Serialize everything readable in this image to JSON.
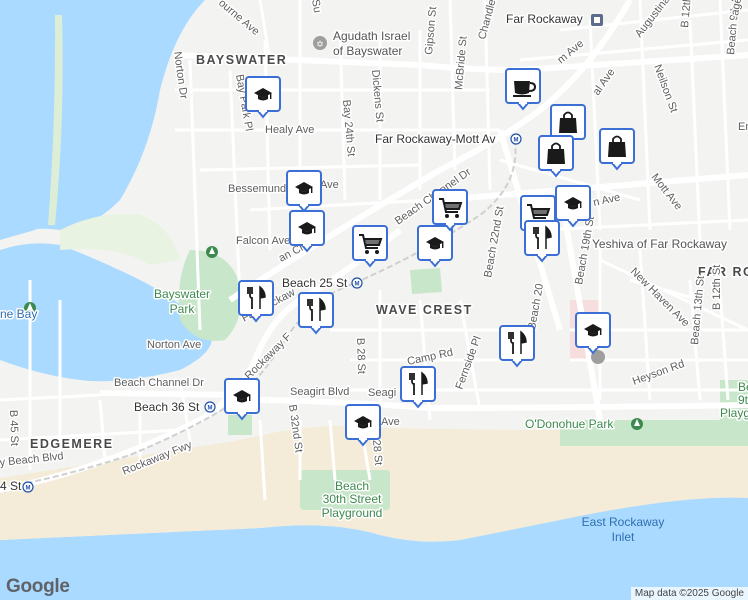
{
  "map": {
    "areas": {
      "bayswater": "BAYSWATER",
      "wave_crest": "WAVE CREST",
      "edgemere": "EDGEMERE",
      "far_rockaway_cut": "FAR RO"
    },
    "parks": {
      "bayswater_park_1": "Bayswater",
      "bayswater_park_2": "Park",
      "odonohue": "O'Donohue Park",
      "beach30_1": "Beach",
      "beach30_2": "30th Street",
      "beach30_3": "Playground",
      "beach9_1": "Be",
      "beach9_2": "9th",
      "beach9_3": "Playg"
    },
    "water": {
      "inlet_1": "East Rockaway",
      "inlet_2": "Inlet",
      "bay": "ne Bay"
    },
    "places": {
      "agudath_1": "Agudath Israel",
      "agudath_2": "of Bayswater",
      "far_rockaway": "Far Rockaway",
      "yeshiva": "Yeshiva of Far Rockaway"
    },
    "stations": {
      "mott_av": "Far Rockaway-Mott Av",
      "beach25": "Beach 25 St",
      "beach36": "Beach 36 St",
      "beach44": "4 St"
    },
    "streets": {
      "ashbourne": "ourne Ave",
      "norton_dr": "Norton Dr",
      "bay_park_pl": "Bay Park Pl",
      "healy": "Healy Ave",
      "bay24": "Bay 24th St",
      "dickens": "Dickens St",
      "gipson": "Gipson St",
      "mcbride": "McBride St",
      "chandler": "Chandler",
      "bessemund": "Bessemund",
      "cornaga": "C",
      "cornaga_ave": "Ave",
      "beach_channel_dr_upper": "Beach Channel Dr",
      "beach_channel_dr_lower": "Beach Channel Dr",
      "falcon": "Falcon Ave",
      "grassmere": "an Cres",
      "far_rockaway_blvd": "Far Rockaw",
      "norton_ave": "Norton Ave",
      "rockaway_fwy_a": "Rockaway F",
      "rockaway_fwy": "Rockaway Fwy",
      "b28": "B 28 St",
      "camp_rd": "Camp Rd",
      "fernside": "Fernside Pl",
      "beach22": "Beach 22nd St",
      "beach20": "Beach 20",
      "beach19": "Beach 19th St",
      "mott_ave": "Mott Ave",
      "new_haven": "New Haven Ave",
      "b12_top": "B 12th St",
      "b12_bot": "B 12th St",
      "beach9": "Beach 9th St",
      "beach13": "Beach 13th St",
      "neilson": "Neilson St",
      "augustina": "Augustina Av",
      "age_st": "age St",
      "seagirt": "Seagirt Blvd",
      "seagirt_2": "Seagi",
      "b32": "B 32nd St",
      "b45": "B 45 St",
      "beach_blvd": "y Beach Blvd",
      "heyson": "Heyson Rd",
      "b28_lower": "28 St",
      "ave_lower": "Ave",
      "ave_nr": "Ave",
      "em": "Em",
      "su": "Su",
      "mott_ave_top": "m Ave",
      "central_ave": "al Ave",
      "ave_right": "n Ave"
    },
    "pins": [
      {
        "type": "school",
        "icon": "school-icon"
      },
      {
        "type": "school",
        "icon": "school-icon"
      },
      {
        "type": "school",
        "icon": "school-icon"
      },
      {
        "type": "school",
        "icon": "school-icon"
      },
      {
        "type": "school",
        "icon": "school-icon"
      },
      {
        "type": "school",
        "icon": "school-icon"
      },
      {
        "type": "school",
        "icon": "school-icon"
      },
      {
        "type": "school",
        "icon": "school-icon"
      },
      {
        "type": "grocery",
        "icon": "shopping-cart-icon"
      },
      {
        "type": "grocery",
        "icon": "shopping-cart-icon"
      },
      {
        "type": "grocery",
        "icon": "shopping-cart-icon"
      },
      {
        "type": "restaurant",
        "icon": "fork-knife-icon"
      },
      {
        "type": "restaurant",
        "icon": "fork-knife-icon"
      },
      {
        "type": "restaurant",
        "icon": "fork-knife-icon"
      },
      {
        "type": "restaurant",
        "icon": "fork-knife-icon"
      },
      {
        "type": "restaurant",
        "icon": "fork-knife-icon"
      },
      {
        "type": "cafe",
        "icon": "coffee-cup-icon"
      },
      {
        "type": "shopping",
        "icon": "shopping-bag-icon"
      },
      {
        "type": "shopping",
        "icon": "shopping-bag-icon"
      },
      {
        "type": "shopping",
        "icon": "shopping-bag-icon"
      }
    ],
    "colors": {
      "water": "#aadaff",
      "park": "#c8e6c9",
      "pin_fill": "#ffffff",
      "pin_border": "#3b6fd6",
      "pin_icon": "#1a1a1a"
    }
  },
  "footer": {
    "logo": "Google",
    "attribution": "Map data ©2025 Google"
  }
}
